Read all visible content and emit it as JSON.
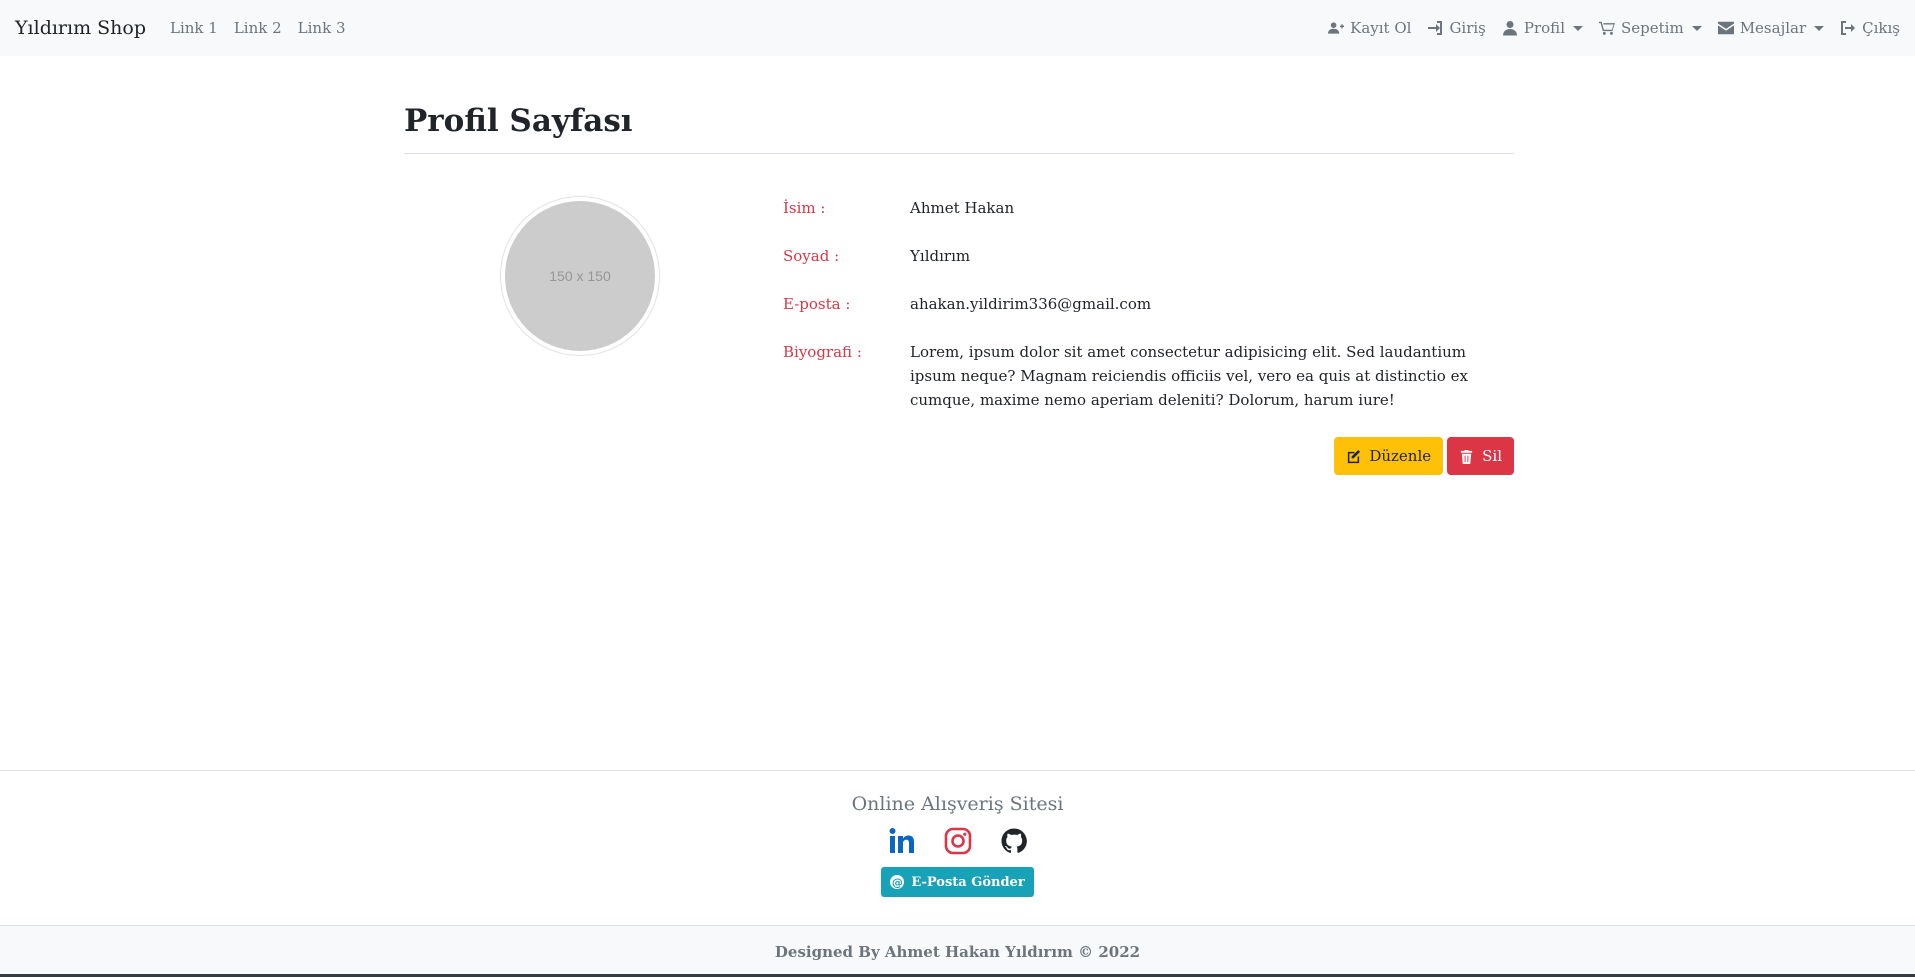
{
  "navbar": {
    "brand": "Yıldırım Shop",
    "left_links": [
      "Link 1",
      "Link 2",
      "Link 3"
    ],
    "right_items": [
      {
        "label": "Kayıt Ol",
        "icon": "user-plus-icon",
        "dropdown": false
      },
      {
        "label": "Giriş",
        "icon": "sign-in-icon",
        "dropdown": false
      },
      {
        "label": "Profil",
        "icon": "user-icon",
        "dropdown": true
      },
      {
        "label": "Sepetim",
        "icon": "cart-icon",
        "dropdown": true
      },
      {
        "label": "Mesajlar",
        "icon": "envelope-icon",
        "dropdown": true
      },
      {
        "label": "Çıkış",
        "icon": "sign-out-icon",
        "dropdown": false
      }
    ]
  },
  "page": {
    "title": "Profil Sayfası",
    "avatar_placeholder": "150 x 150",
    "fields": [
      {
        "label": "İsim :",
        "value": "Ahmet Hakan"
      },
      {
        "label": "Soyad :",
        "value": "Yıldırım"
      },
      {
        "label": "E-posta :",
        "value": "ahakan.yildirim336@gmail.com"
      },
      {
        "label": "Biyografi :",
        "value": "Lorem, ipsum dolor sit amet consectetur adipisicing elit. Sed laudantium ipsum neque? Magnam reiciendis officiis vel, vero ea quis at distinctio ex cumque, maxime nemo aperiam deleniti? Dolorum, harum iure!"
      }
    ],
    "edit_button": "Düzenle",
    "delete_button": "Sil"
  },
  "footer": {
    "title": "Online Alışveriş Sitesi",
    "social": [
      "linkedin-icon",
      "instagram-icon",
      "github-icon"
    ],
    "email_button": "E-Posta Gönder",
    "copyright": "Designed By Ahmet Hakan Yıldırım © 2022"
  },
  "colors": {
    "accent_label": "#dc3545",
    "warning": "#ffc107",
    "danger": "#dc3545",
    "info": "#17a2b8",
    "linkedin": "#0a66c2",
    "instagram": "#dc3545",
    "github": "#212529"
  }
}
